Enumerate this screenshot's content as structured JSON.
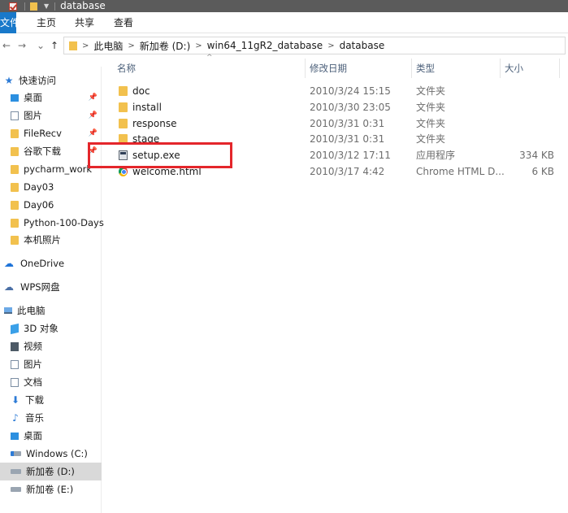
{
  "titlebar": {
    "title": "database"
  },
  "ribbon": {
    "tabs": [
      "文件",
      "主页",
      "共享",
      "查看"
    ]
  },
  "nav": {
    "back": "←",
    "forward": "→",
    "recent": "⌄",
    "up": "↑"
  },
  "address": {
    "crumbs": [
      "此电脑",
      "新加卷 (D:)",
      "win64_11gR2_database",
      "database"
    ]
  },
  "sidebar": {
    "quick_access": "快速访问",
    "items": [
      {
        "label": "桌面",
        "pinned": true
      },
      {
        "label": "图片",
        "pinned": true
      },
      {
        "label": "FileRecv",
        "pinned": true
      },
      {
        "label": "谷歌下载",
        "pinned": true
      },
      {
        "label": "pycharm_work",
        "pinned": true
      },
      {
        "label": "Day03"
      },
      {
        "label": "Day06"
      },
      {
        "label": "Python-100-Days"
      },
      {
        "label": "本机照片"
      }
    ],
    "onedrive": "OneDrive",
    "wps": "WPS网盘",
    "this_pc": "此电脑",
    "pc_items": [
      "3D 对象",
      "视频",
      "图片",
      "文档",
      "下载",
      "音乐",
      "桌面"
    ],
    "drives": [
      "Windows (C:)",
      "新加卷 (D:)",
      "新加卷 (E:)"
    ],
    "selected_drive": "新加卷 (D:)"
  },
  "columns": {
    "name": "名称",
    "date": "修改日期",
    "type": "类型",
    "size": "大小"
  },
  "files": [
    {
      "name": "doc",
      "date": "2010/3/24 15:15",
      "type": "文件夹",
      "size": "",
      "icon": "folder-icon"
    },
    {
      "name": "install",
      "date": "2010/3/30 23:05",
      "type": "文件夹",
      "size": "",
      "icon": "folder-icon"
    },
    {
      "name": "response",
      "date": "2010/3/31 0:31",
      "type": "文件夹",
      "size": "",
      "icon": "folder-icon"
    },
    {
      "name": "stage",
      "date": "2010/3/31 0:31",
      "type": "文件夹",
      "size": "",
      "icon": "folder-icon"
    },
    {
      "name": "setup.exe",
      "date": "2010/3/12 17:11",
      "type": "应用程序",
      "size": "334 KB",
      "icon": "exe-icon"
    },
    {
      "name": "welcome.html",
      "date": "2010/3/17 4:42",
      "type": "Chrome HTML D...",
      "size": "6 KB",
      "icon": "chrome-icon"
    }
  ],
  "colors": {
    "highlight": "#e4262b",
    "folder": "#f2c14e",
    "accent": "#1979ca"
  }
}
